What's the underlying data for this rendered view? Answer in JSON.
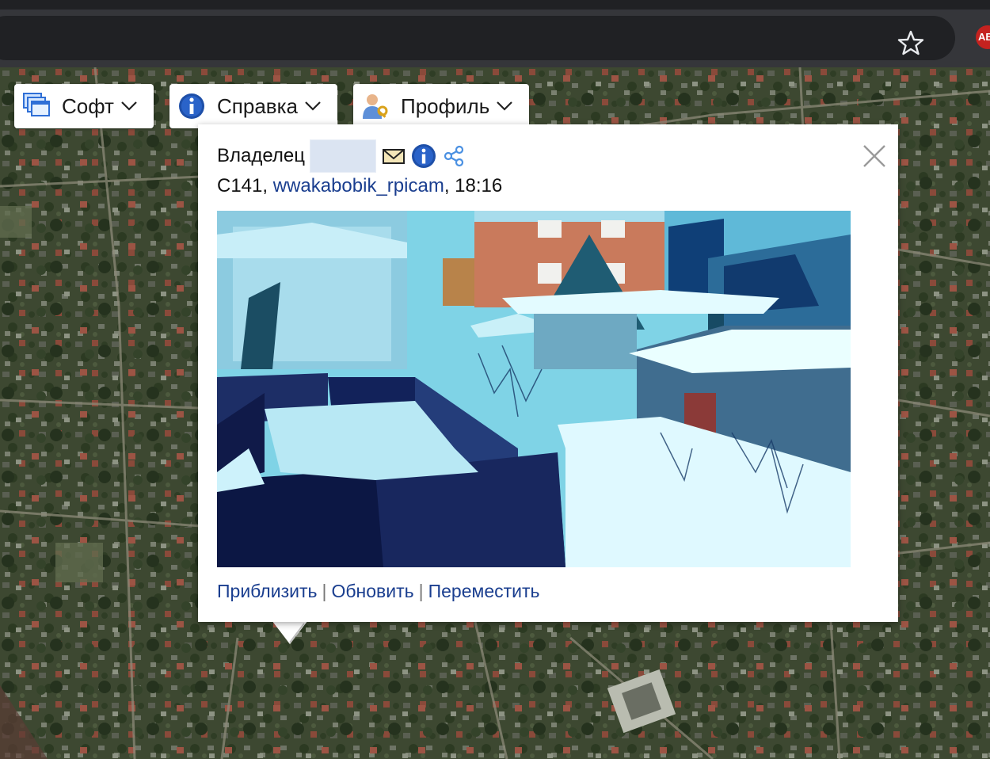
{
  "browser": {
    "extension_badge": "AB"
  },
  "toolbar": {
    "soft_label": "Софт",
    "help_label": "Справка",
    "profile_label": "Профиль"
  },
  "popup": {
    "owner_label": "Владелец",
    "camera_id": "C141",
    "camera_name": "wwakabobik_rpicam",
    "time": "18:16",
    "actions": {
      "zoom_in": "Приблизить",
      "refresh": "Обновить",
      "move": "Переместить",
      "separator": "|"
    }
  },
  "colors": {
    "link": "#1a3e8f",
    "chrome_dark": "#202124",
    "chrome_bar": "#35363a"
  }
}
